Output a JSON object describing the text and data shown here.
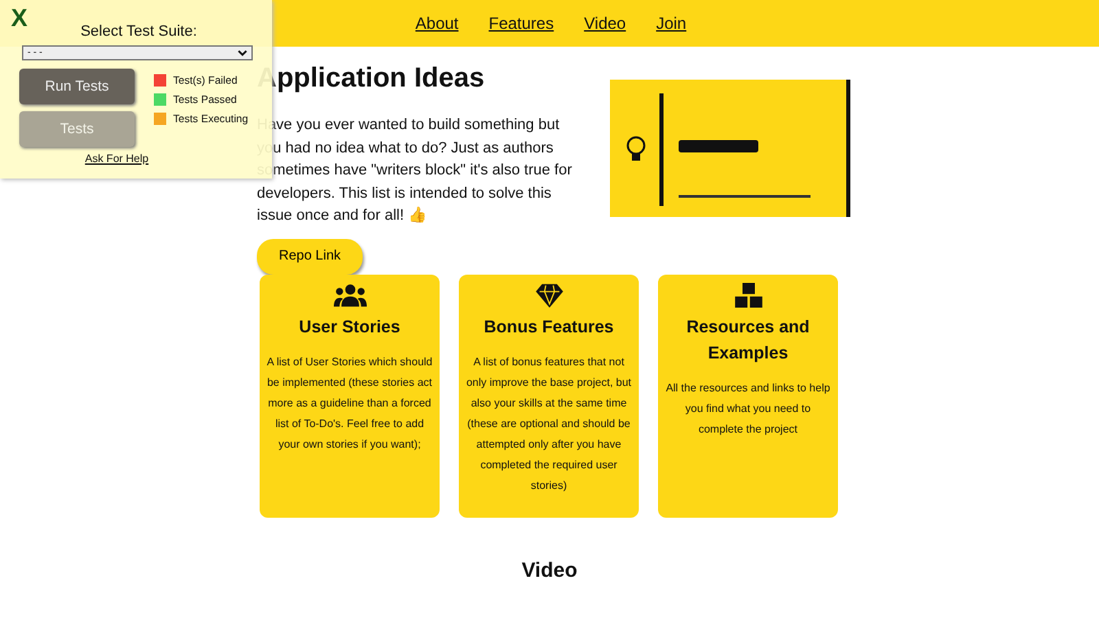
{
  "nav": [
    {
      "label": "About"
    },
    {
      "label": "Features"
    },
    {
      "label": "Video"
    },
    {
      "label": "Join"
    }
  ],
  "intro": {
    "title": "Application Ideas",
    "text": "Have you ever wanted to build something but you had no idea what to do? Just as authors sometimes have \"writers block\" it's also true for developers. This list is intended to solve this issue once and for all! 👍",
    "button": "Repo Link"
  },
  "cards": [
    {
      "kind": "users",
      "title": "User Stories",
      "text": "A list of User Stories which should be implemented (these stories act more as a guideline than a forced list of To-Do's. Feel free to add your own stories if you want);"
    },
    {
      "kind": "gem",
      "title": "Bonus Features",
      "text": "A list of bonus features that not only improve the base project, but also your skills at the same time (these are optional and should be attempted only after you have completed the required user stories)"
    },
    {
      "kind": "boxes",
      "title": "Resources and Examples",
      "text": "All the resources and links to help you find what you need to complete the project"
    }
  ],
  "video_heading": "Video",
  "test_panel": {
    "close": "X",
    "label": "Select Test Suite:",
    "select_value": "- - -",
    "buttons": [
      {
        "label": "Run Tests",
        "disabled": false
      },
      {
        "label": "Tests",
        "disabled": true
      }
    ],
    "legend": [
      {
        "label": "Test(s) Failed",
        "color": "#f44336"
      },
      {
        "label": "Tests Passed",
        "color": "#4cd964"
      },
      {
        "label": "Tests Executing",
        "color": "#f5a623"
      }
    ],
    "help": "Ask For Help"
  }
}
